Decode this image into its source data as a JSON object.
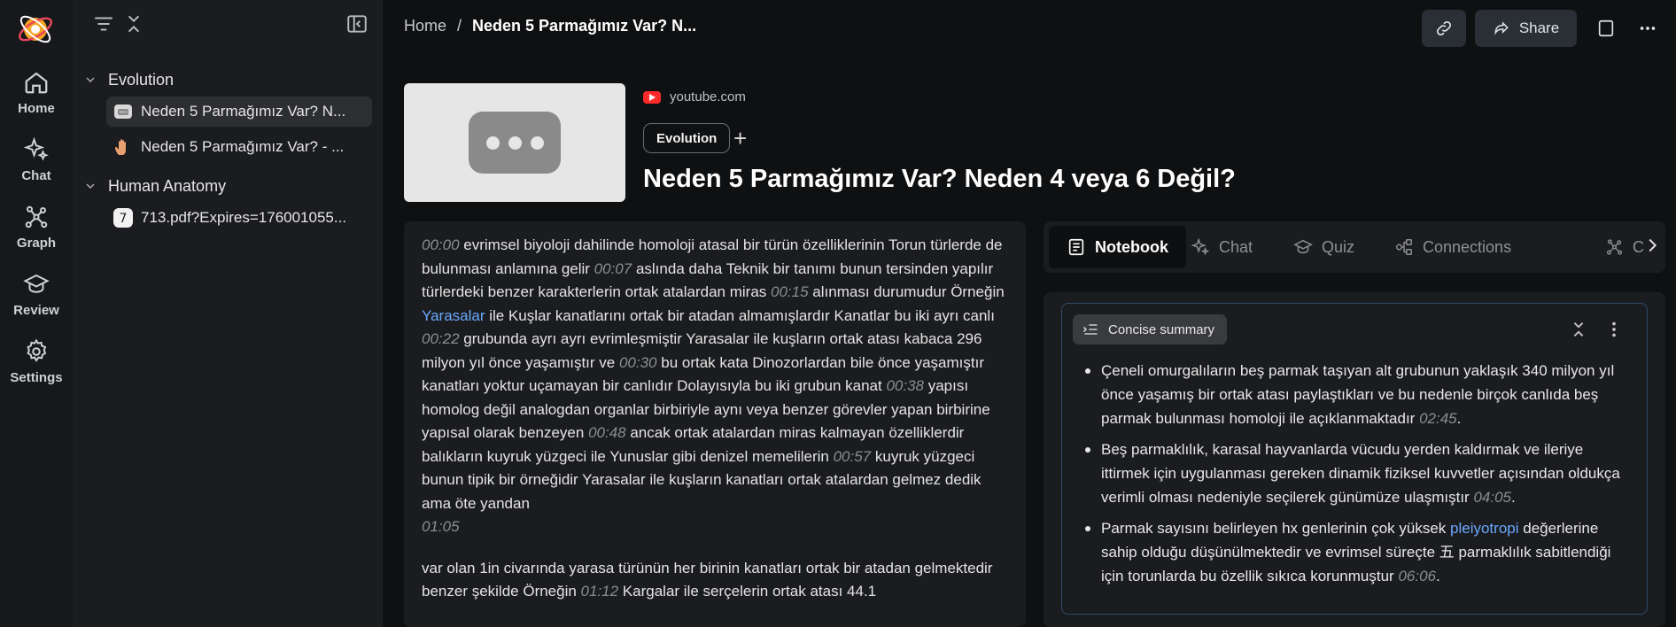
{
  "nav": {
    "items": [
      {
        "label": "Home",
        "icon": "home-icon"
      },
      {
        "label": "Chat",
        "icon": "sparkle-icon"
      },
      {
        "label": "Graph",
        "icon": "graph-icon"
      },
      {
        "label": "Review",
        "icon": "graduation-cap-icon"
      },
      {
        "label": "Settings",
        "icon": "gear-icon"
      }
    ]
  },
  "sidebar": {
    "groups": [
      {
        "name": "Evolution",
        "items": [
          {
            "label": "Neden 5 Parmağımız Var? N...",
            "icon": "video-icon",
            "active": true
          },
          {
            "label": "Neden 5 Parmağımız Var? - ...",
            "icon": "hand-icon",
            "active": false
          }
        ]
      },
      {
        "name": "Human Anatomy",
        "items": [
          {
            "label": "713.pdf?Expires=176001055...",
            "icon": "number-7-icon",
            "active": false
          }
        ]
      }
    ]
  },
  "breadcrumb": {
    "home": "Home",
    "separator": "/",
    "current": "Neden 5 Parmağımız Var? N..."
  },
  "toolbar": {
    "share_label": "Share"
  },
  "header": {
    "source": "youtube.com",
    "tag": "Evolution",
    "title": "Neden 5 Parmağımız Var? Neden 4 veya 6 Değil?"
  },
  "transcript": {
    "para1": [
      {
        "t": "00:00",
        "s": "evrimsel biyoloji dahilinde homoloji atasal bir türün özelliklerinin Torun türlerde de bulunması anlamına gelir "
      },
      {
        "t": "00:07",
        "s": "aslında daha Teknik bir tanımı bunun tersinden yapılır türlerdeki benzer karakterlerin ortak atalardan miras "
      },
      {
        "t": "00:15",
        "s": "alınması durumudur Örneğin ",
        "link": "Yarasalar",
        "after": " ile Kuşlar kanatlarını ortak bir atadan almamışlardır Kanatlar bu iki ayrı canlı "
      },
      {
        "t": "00:22",
        "s": "grubunda ayrı ayrı evrimleşmiştir Yarasalar ile kuşların ortak atası kabaca 296 milyon yıl önce yaşamıştır ve "
      },
      {
        "t": "00:30",
        "s": "bu ortak kata Dinozorlardan bile önce yaşamıştır kanatları yoktur uçamayan bir canlıdır Dolayısıyla bu iki grubun kanat "
      },
      {
        "t": "00:38",
        "s": "yapısı homolog değil analogdan organlar birbiriyle aynı veya benzer görevler yapan birbirine yapısal olarak benzeyen "
      },
      {
        "t": "00:48",
        "s": "ancak ortak atalardan miras kalmayan özelliklerdir balıkların kuyruk yüzgeci ile Yunuslar gibi denizel memelilerin "
      },
      {
        "t": "00:57",
        "s": "kuyruk yüzgeci bunun tipik bir örneğidir Yarasalar ile kuşların kanatları ortak atalardan gelmez dedik ama öte yandan"
      }
    ],
    "end_ts": "01:05",
    "para2_a": "var olan 1in civarında yarasa türünün her birinin kanatları ortak bir atadan gelmektedir benzer şekilde Örneğin ",
    "para2_ts": "01:12",
    "para2_b": " Kargalar ile serçelerin ortak atası 44.1"
  },
  "tabs": [
    {
      "label": "Notebook",
      "icon": "notebook-icon",
      "active": true
    },
    {
      "label": "Chat",
      "icon": "sparkle-icon",
      "active": false
    },
    {
      "label": "Quiz",
      "icon": "graduation-cap-icon",
      "active": false
    },
    {
      "label": "Connections",
      "icon": "connections-icon",
      "active": false
    },
    {
      "label": "C",
      "icon": "graph-icon",
      "active": false
    }
  ],
  "notebook": {
    "chip": "Concise summary",
    "bullets": [
      {
        "text": "Çeneli omurgalıların beş parmak taşıyan alt grubunun yaklaşık 340 milyon yıl önce yaşamış bir ortak atası paylaştıkları ve bu nedenle birçok canlıda beş parmak bulunması homoloji ile açıklanmaktadır ",
        "ts": "02:45",
        "end": "."
      },
      {
        "text": "Beş parmaklılık, karasal hayvanlarda vücudu yerden kaldırmak ve ileriye ittirmek için uygulanması gereken dinamik fiziksel kuvvetler açısından oldukça verimli olması nedeniyle seçilerek günümüze ulaşmıştır ",
        "ts": "04:05",
        "end": "."
      },
      {
        "pre": "Parmak sayısını belirleyen hx genlerinin çok yüksek ",
        "link": "pleiyotropi",
        "text": " değerlerine sahip olduğu düşünülmektedir ve evrimsel süreçte 五 parmaklılık sabitlendiği için torunlarda bu özellik sıkıca korunmuştur ",
        "ts": "06:06",
        "end": "."
      }
    ]
  },
  "colors": {
    "accent_link": "#6aa8ff",
    "youtube_red": "#ff2b2b",
    "card_border": "#2f4a6b"
  }
}
